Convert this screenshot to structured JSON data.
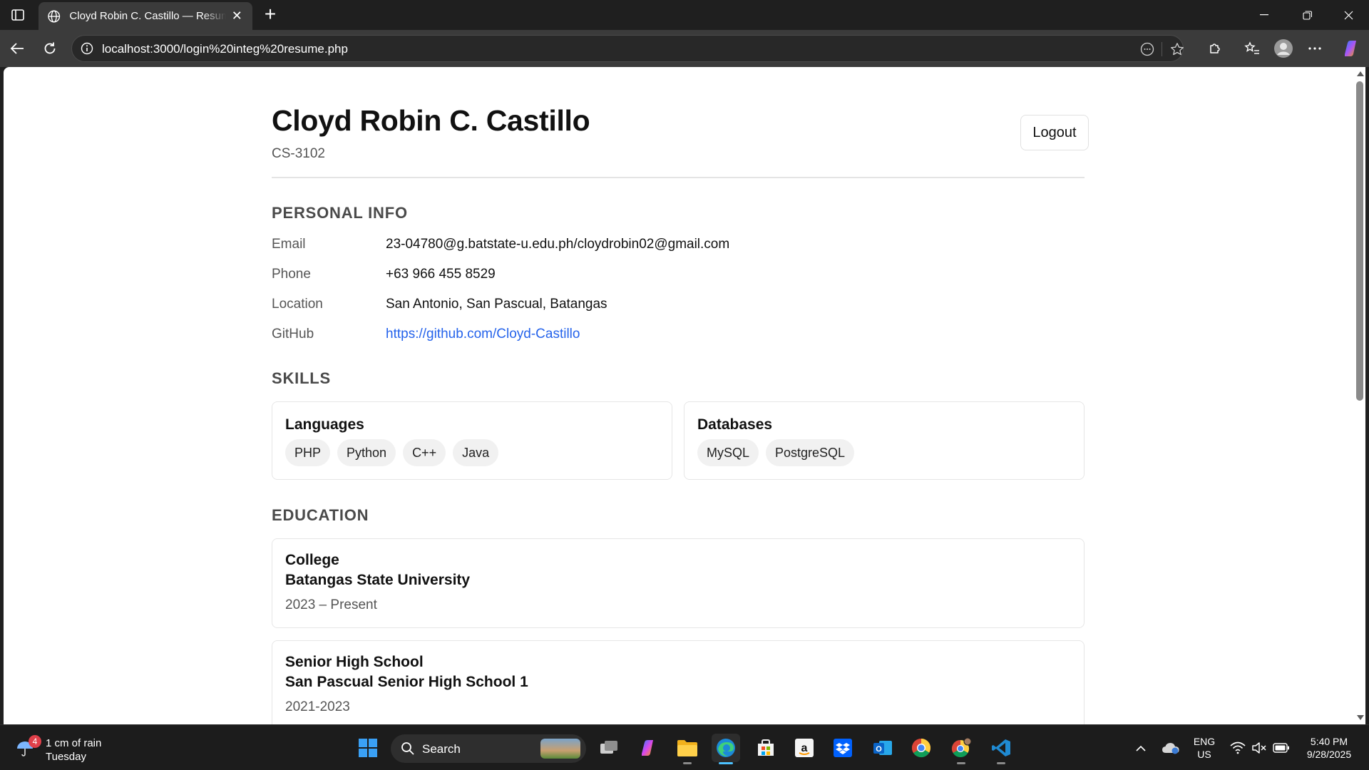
{
  "browser": {
    "tab_title": "Cloyd Robin C. Castillo — Resume",
    "url": "localhost:3000/login%20integ%20resume.php"
  },
  "resume": {
    "name": "Cloyd Robin C. Castillo",
    "section": "CS-3102",
    "logout_label": "Logout",
    "personal_info": {
      "heading": "PERSONAL INFO",
      "rows": [
        {
          "label": "Email",
          "value": "23-04780@g.batstate-u.edu.ph/cloydrobin02@gmail.com"
        },
        {
          "label": "Phone",
          "value": "+63 966 455 8529"
        },
        {
          "label": "Location",
          "value": "San Antonio, San Pascual, Batangas"
        },
        {
          "label": "GitHub",
          "value": "https://github.com/Cloyd-Castillo"
        }
      ]
    },
    "skills": {
      "heading": "SKILLS",
      "groups": [
        {
          "title": "Languages",
          "items": [
            "PHP",
            "Python",
            "C++",
            "Java"
          ]
        },
        {
          "title": "Databases",
          "items": [
            "MySQL",
            "PostgreSQL"
          ]
        }
      ]
    },
    "education": {
      "heading": "EDUCATION",
      "entries": [
        {
          "level": "College",
          "school": "Batangas State University",
          "years": "2023 – Present"
        },
        {
          "level": "Senior High School",
          "school": "San Pascual Senior High School 1",
          "years": "2021-2023"
        }
      ]
    }
  },
  "taskbar": {
    "weather_badge": "4",
    "weather_line1": "1 cm of rain",
    "weather_line2": "Tuesday",
    "search_label": "Search",
    "lang_line1": "ENG",
    "lang_line2": "US",
    "time": "5:40 PM",
    "date": "9/28/2025"
  },
  "colors": {
    "link": "#2563eb",
    "edge_active": "#4cc2ff",
    "badge": "#e0404a"
  }
}
